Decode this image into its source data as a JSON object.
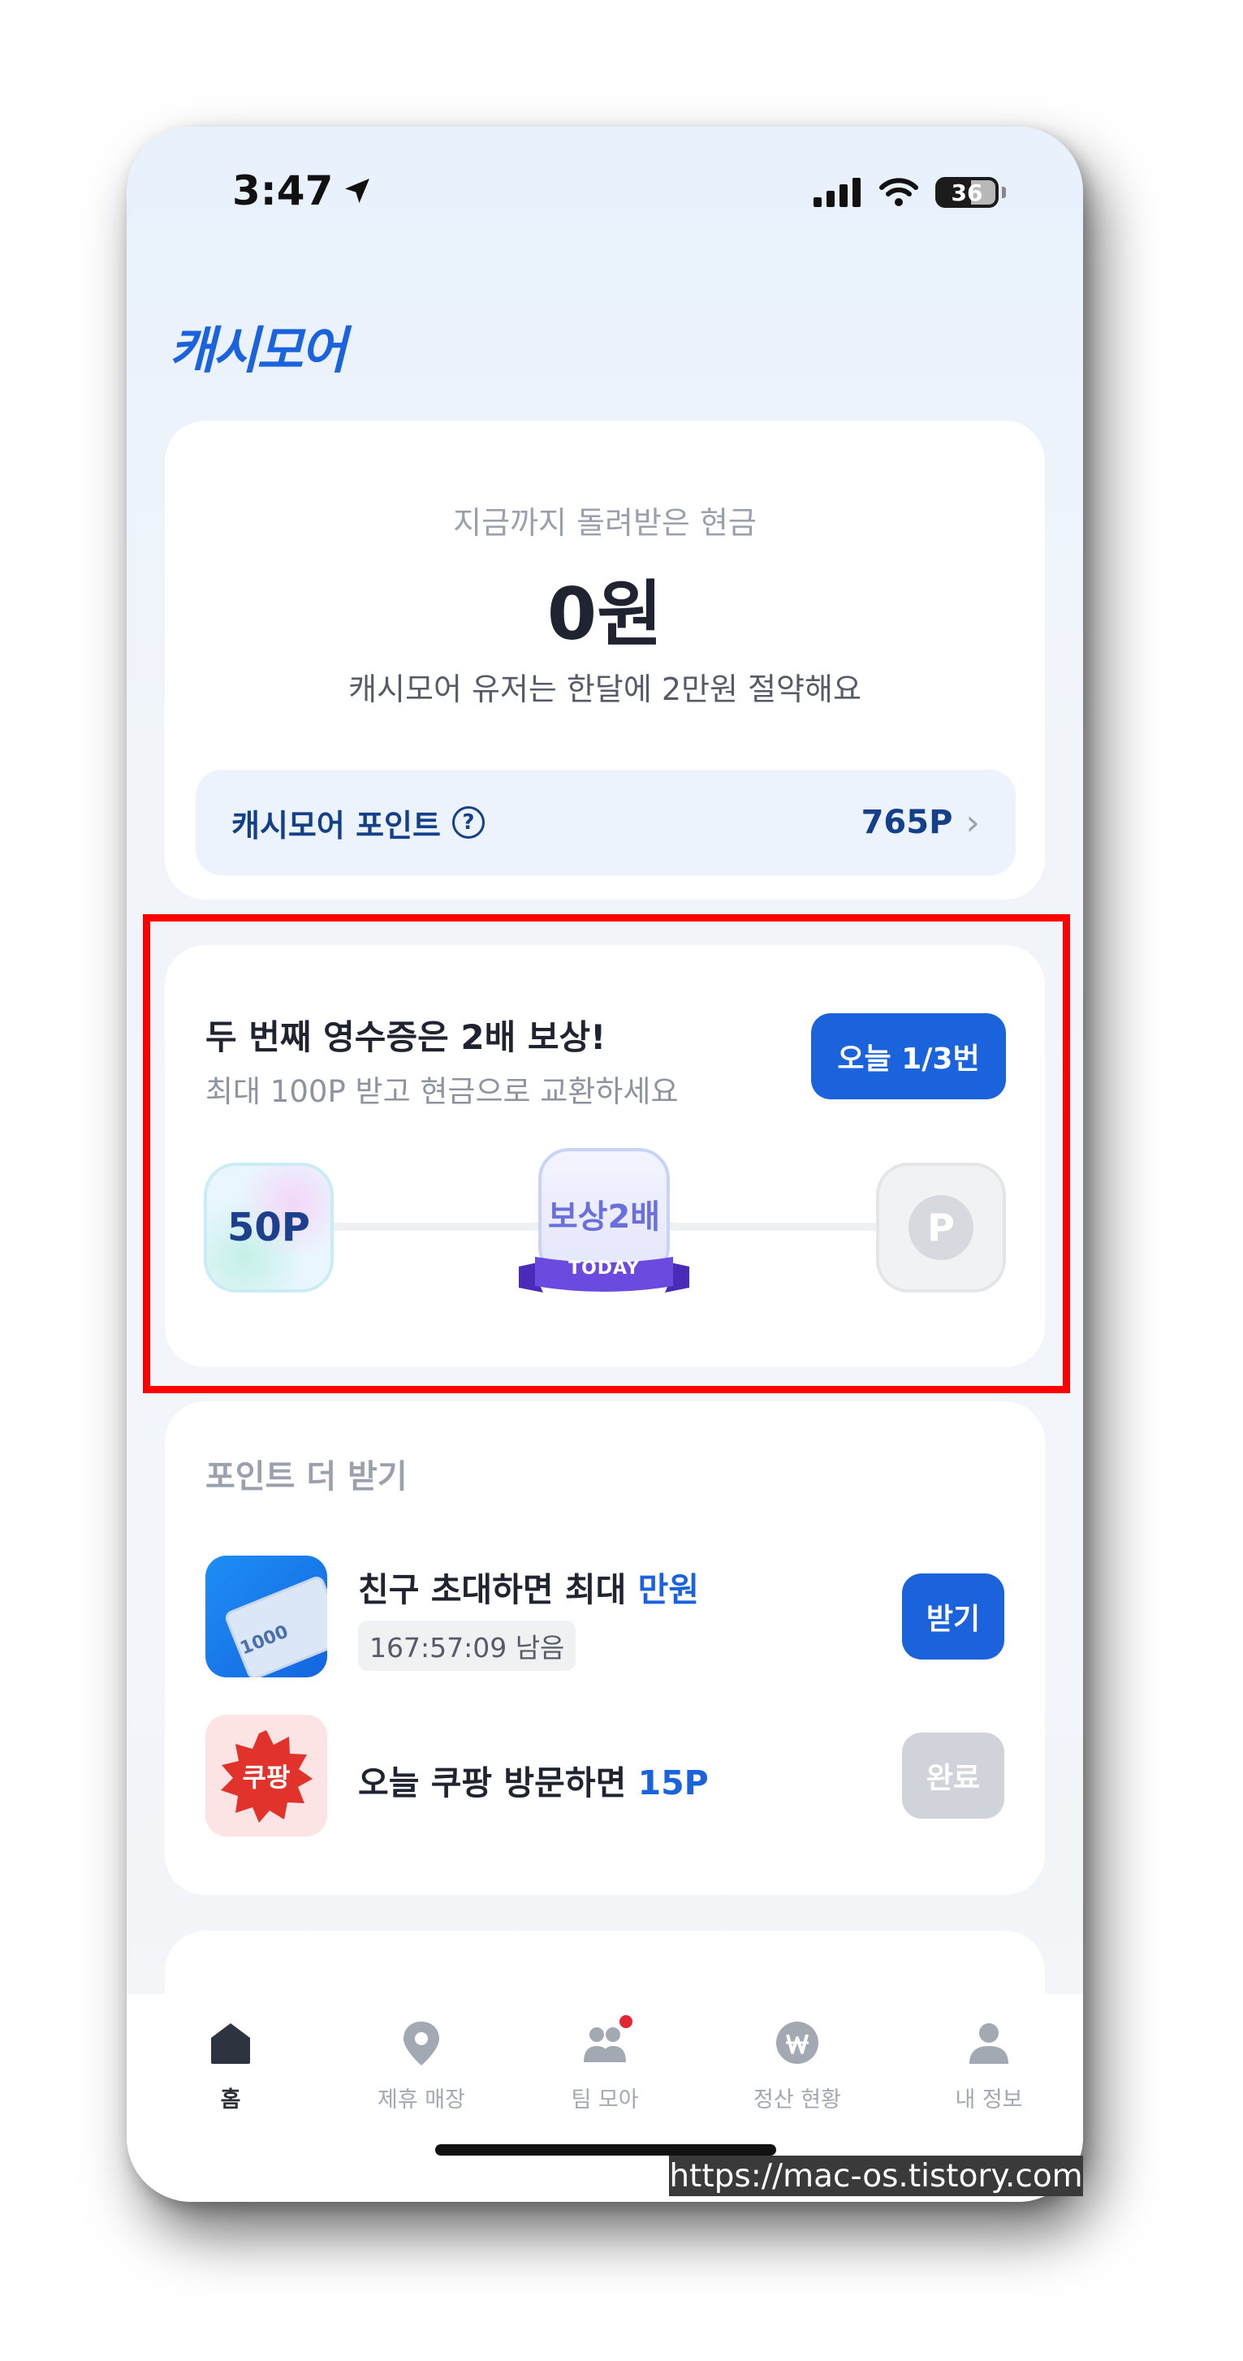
{
  "status_bar": {
    "time": "3:47",
    "battery": "36"
  },
  "brand": "캐시모어",
  "summary": {
    "subtitle": "지금까지 돌려받은 현금",
    "amount": "0원",
    "description": "캐시모어 유저는 한달에 2만원 절약해요",
    "points_label": "캐시모어 포인트",
    "points_value": "765P"
  },
  "receipt": {
    "title": "두 번째 영수증은 2배 보상!",
    "subtitle": "최대 100P 받고 현금으로 교환하세요",
    "today_button": "오늘 1/3번",
    "step1": "50P",
    "step2": "보상2배",
    "step2_ribbon": "TODAY",
    "step3": "P"
  },
  "more_points": {
    "title": "포인트 더 받기",
    "task1_prefix": "친구 초대하면 최대 ",
    "task1_accent": "만원",
    "task1_timer": "167:57:09 남음",
    "task1_button": "받기",
    "task1_bill": "1000",
    "task2_icon_text": "쿠팡",
    "task2_prefix": "오늘 쿠팡 방문하면 ",
    "task2_accent": "15P",
    "task2_button": "완료"
  },
  "tabs": [
    "홈",
    "제휴 매장",
    "팀 모아",
    "정산 현황",
    "내 정보"
  ],
  "watermark": "https://mac-os.tistory.com",
  "colors": {
    "brand_blue": "#1b63dc",
    "highlight_red": "#ff0000",
    "notification_red": "#e52531"
  }
}
